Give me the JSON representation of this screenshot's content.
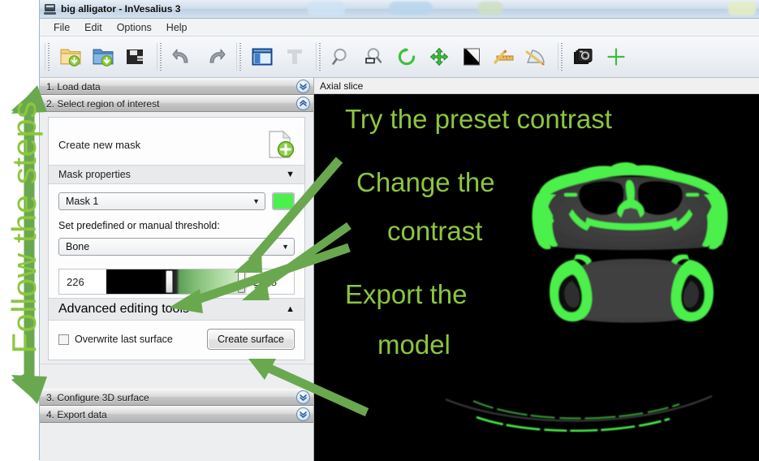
{
  "window": {
    "title": "big alligator - InVesalius 3",
    "icon": "application-window-icon"
  },
  "menubar": {
    "items": [
      {
        "label": "File",
        "name": "menu-file"
      },
      {
        "label": "Edit",
        "name": "menu-edit"
      },
      {
        "label": "Options",
        "name": "menu-options"
      },
      {
        "label": "Help",
        "name": "menu-help"
      }
    ]
  },
  "toolbar": {
    "groups": [
      {
        "tools": [
          {
            "name": "import-dicom-icon",
            "title": "Import DICOM"
          },
          {
            "name": "open-project-icon",
            "title": "Open project"
          },
          {
            "name": "save-project-icon",
            "title": "Save project"
          }
        ]
      },
      {
        "tools": [
          {
            "name": "undo-icon",
            "title": "Undo"
          },
          {
            "name": "redo-icon",
            "title": "Redo"
          }
        ]
      },
      {
        "tools": [
          {
            "name": "layout-icon",
            "title": "Layout"
          },
          {
            "name": "text-annotation-icon",
            "title": "Text"
          }
        ]
      },
      {
        "tools": [
          {
            "name": "zoom-icon",
            "title": "Zoom"
          },
          {
            "name": "zoom-region-icon",
            "title": "Zoom region"
          },
          {
            "name": "rotate-icon",
            "title": "Rotate"
          },
          {
            "name": "pan-icon",
            "title": "Pan / move"
          },
          {
            "name": "contrast-icon",
            "title": "Window level / contrast"
          },
          {
            "name": "measure-linear-icon",
            "title": "Linear measure"
          },
          {
            "name": "measure-angular-icon",
            "title": "Angular measure"
          }
        ]
      },
      {
        "tools": [
          {
            "name": "screenshot-icon",
            "title": "Capture screenshot"
          },
          {
            "name": "crosshair-icon",
            "title": "Cross intersection"
          }
        ]
      }
    ]
  },
  "sidebar": {
    "steps": [
      {
        "label": "1. Load data",
        "name": "step-load-data",
        "expanded": false,
        "chevron": "chevron-double-down-icon"
      },
      {
        "label": "2. Select region of interest",
        "name": "step-select-roi",
        "expanded": true,
        "chevron": "chevron-double-up-icon"
      },
      {
        "label": "3. Configure 3D surface",
        "name": "step-configure-surface",
        "expanded": false,
        "chevron": "chevron-double-down-icon"
      },
      {
        "label": "4. Export data",
        "name": "step-export-data",
        "expanded": false,
        "chevron": "chevron-double-down-icon"
      }
    ]
  },
  "roi": {
    "create_new_mask_label": "Create new mask",
    "new_mask_icon": "new-mask-document-icon",
    "mask_properties_label": "Mask properties",
    "mask_properties_arrow": "▼",
    "mask_select_value": "Mask 1",
    "mask_select_arrow": "▼",
    "mask_color": "#4CF04C",
    "threshold_label": "Set predefined or manual threshold:",
    "preset_value": "Bone",
    "preset_arrow": "▼",
    "threshold_min": "226",
    "threshold_max": "2458",
    "advanced_tools_label": "Advanced editing tools",
    "advanced_tools_arrow": "▲",
    "overwrite_label": "Overwrite last surface",
    "overwrite_checked": false,
    "create_surface_label": "Create surface"
  },
  "viewer": {
    "header": "Axial slice",
    "background": "#000000",
    "mask_overlay_color": "#4CF04C"
  },
  "annotations": {
    "accent_color": "#8cc63e",
    "follow_steps": "Follow the steps",
    "items": [
      {
        "name": "annotation-try-preset-contrast",
        "text": "Try the preset contrast"
      },
      {
        "name": "annotation-change-contrast-line1",
        "text": "Change the"
      },
      {
        "name": "annotation-change-contrast-line2",
        "text": "contrast"
      },
      {
        "name": "annotation-export-model-line1",
        "text": "Export the"
      },
      {
        "name": "annotation-export-model-line2",
        "text": "model"
      }
    ]
  }
}
